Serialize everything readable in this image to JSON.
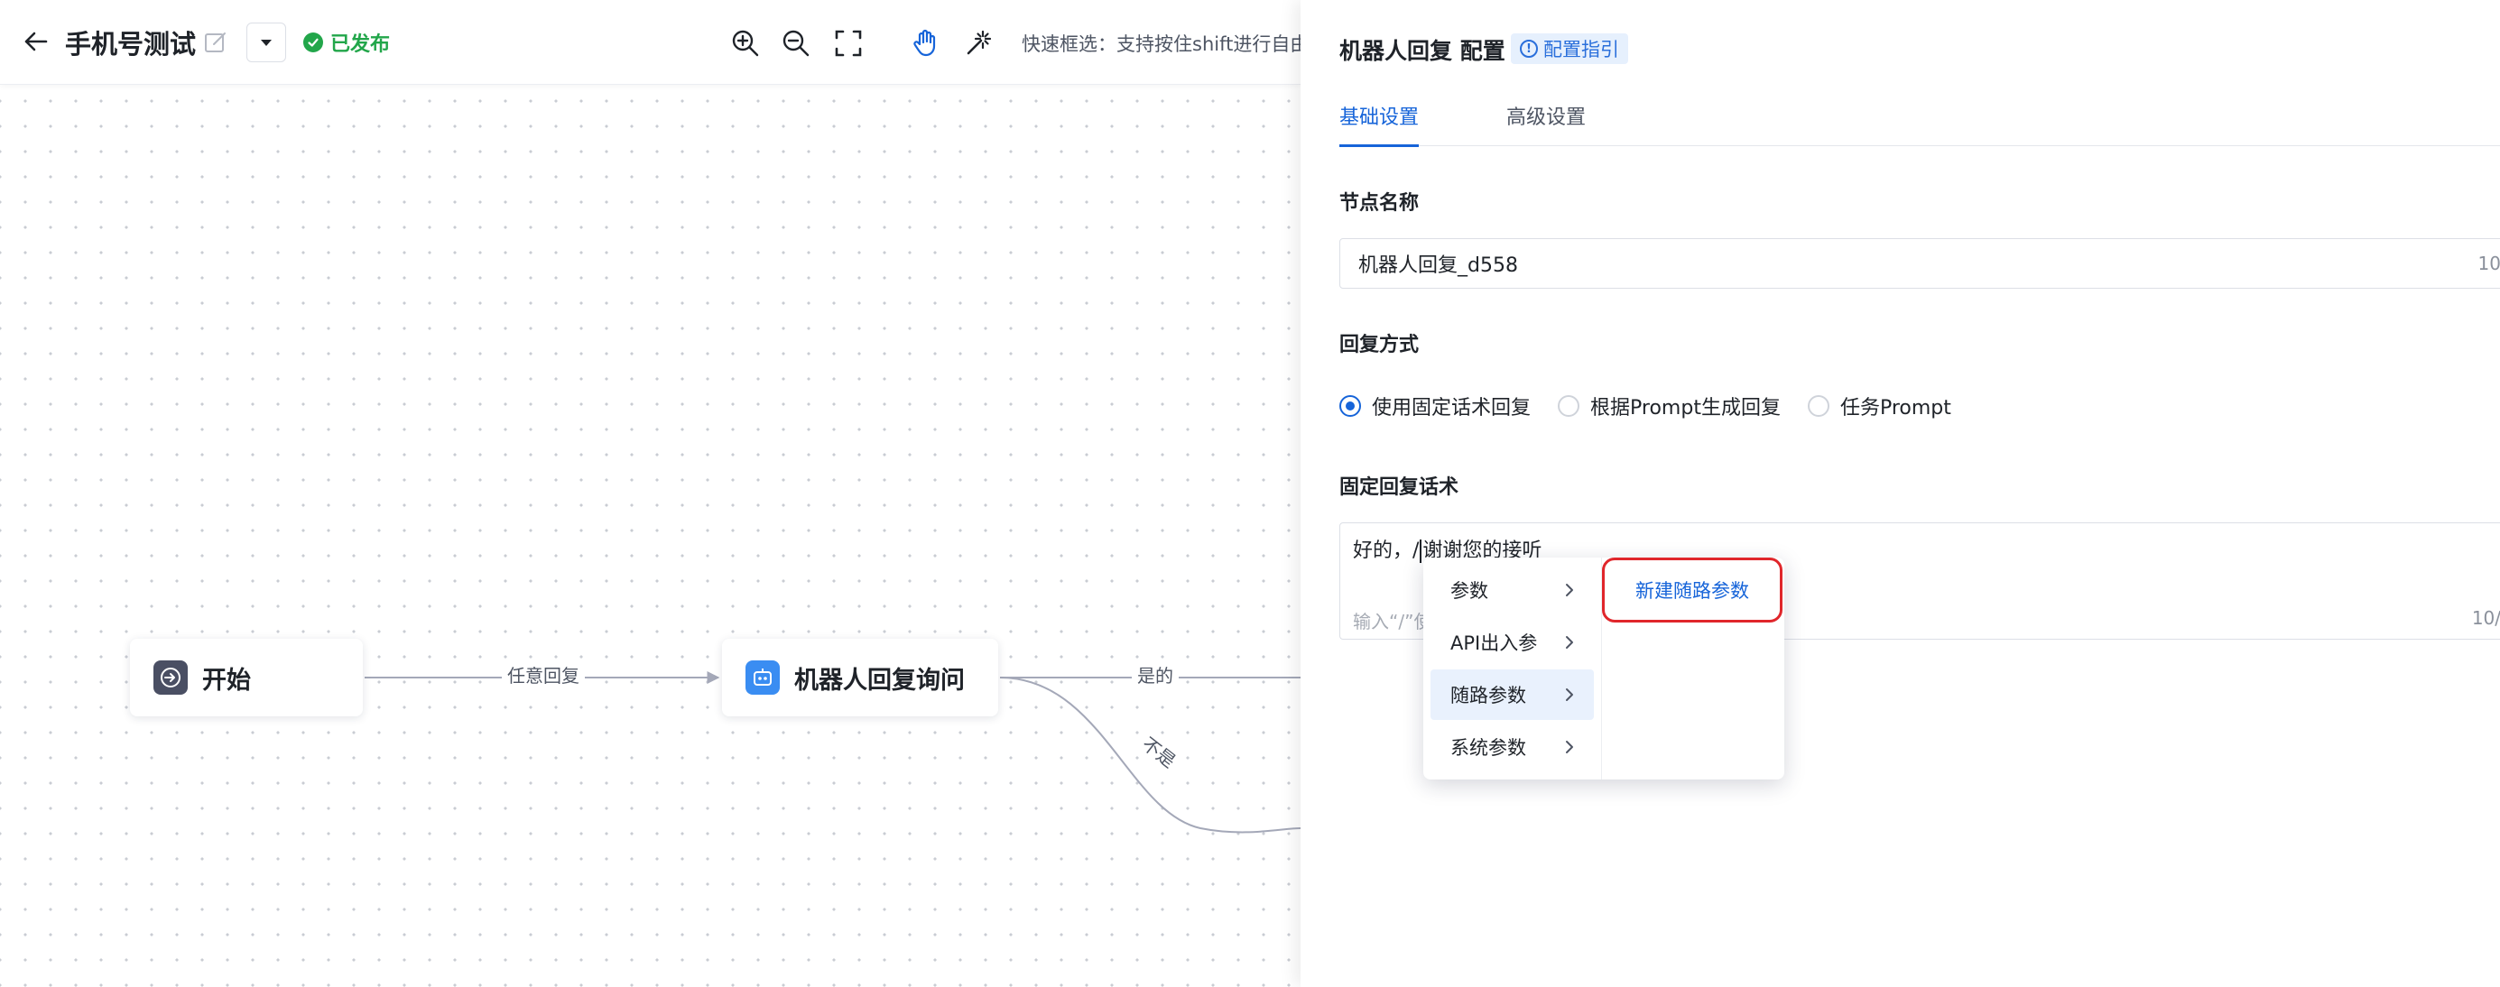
{
  "toolbar": {
    "flow_title": "手机号测试",
    "status_text": "已发布",
    "select_hint": "快速框选：支持按住shift进行自由"
  },
  "canvas": {
    "nodes": {
      "start_label": "开始",
      "robot_label": "机器人回复询问"
    },
    "edges": {
      "any_reply": "任意回复",
      "yes": "是的",
      "no": "不是"
    }
  },
  "panel": {
    "title": "机器人回复 配置",
    "guide_label": "配置指引",
    "tabs": [
      {
        "label": "基础设置",
        "active": true
      },
      {
        "label": "高级设置",
        "active": false
      }
    ],
    "node_name": {
      "label": "节点名称",
      "value": "机器人回复_d558",
      "count": "10"
    },
    "reply_mode": {
      "label": "回复方式",
      "options": [
        {
          "label": "使用固定话术回复",
          "checked": true
        },
        {
          "label": "根据Prompt生成回复",
          "checked": false
        },
        {
          "label": "任务Prompt",
          "checked": false
        }
      ]
    },
    "fixed_reply": {
      "label": "固定回复话术",
      "text_before": "好的，/",
      "text_after": "谢谢您的接听",
      "placeholder": "输入“/”使",
      "count": "10/"
    }
  },
  "insert_menu": {
    "items": [
      {
        "label": "参数",
        "active": false
      },
      {
        "label": "API出入参",
        "active": false
      },
      {
        "label": "随路参数",
        "active": true
      },
      {
        "label": "系统参数",
        "active": false
      }
    ],
    "submenu_action": "新建随路参数"
  },
  "colors": {
    "primary": "#1664d9",
    "status_green": "#22a64a",
    "highlight_red": "#e0262b"
  }
}
